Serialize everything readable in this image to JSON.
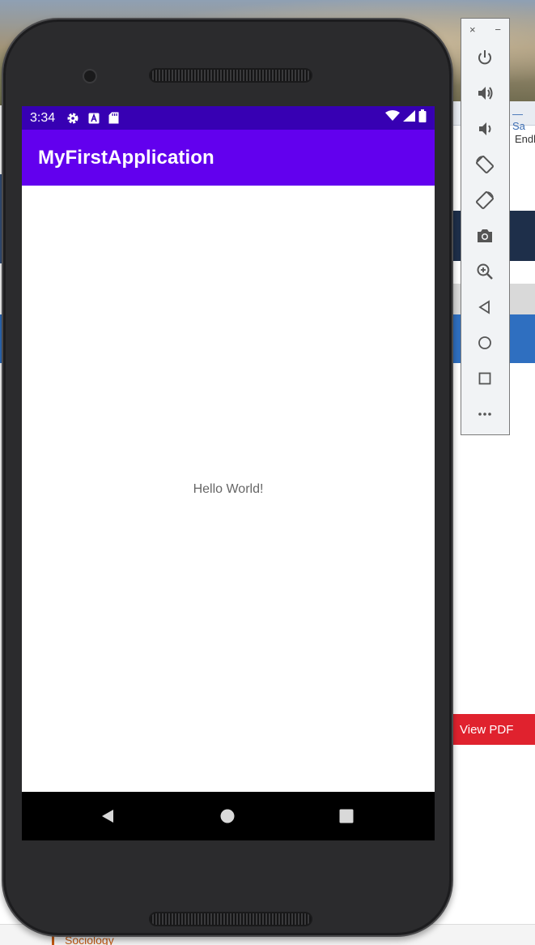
{
  "background": {
    "tab_text": "— Sa",
    "side_text": "Endl",
    "view_pdf_label": "View PDF",
    "bottom_link": "Sociology"
  },
  "status_bar": {
    "time": "3:34",
    "left_icons": [
      "gear-icon",
      "a-icon",
      "sd-card-icon"
    ],
    "right_icons": [
      "wifi-icon",
      "signal-icon",
      "battery-icon"
    ]
  },
  "app_bar": {
    "title": "MyFirstApplication"
  },
  "content": {
    "message": "Hello World!"
  },
  "nav_bar": {
    "buttons": [
      "back-icon",
      "home-icon",
      "recents-icon"
    ]
  },
  "emulator_toolbar": {
    "close_label": "×",
    "minimize_label": "−",
    "buttons": [
      "power-icon",
      "volume-up-icon",
      "volume-down-icon",
      "rotate-left-icon",
      "rotate-right-icon",
      "camera-icon",
      "zoom-icon",
      "back-icon",
      "home-icon",
      "overview-icon",
      "more-icon"
    ]
  },
  "colors": {
    "status_bar": "#3700b3",
    "app_bar": "#6200ee",
    "view_pdf": "#e0222e"
  }
}
